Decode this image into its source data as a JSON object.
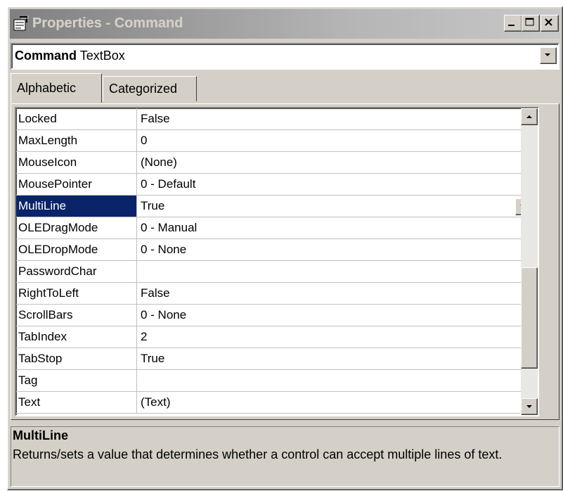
{
  "window": {
    "title": "Properties - Command",
    "icon": "properties-icon"
  },
  "caption_buttons": [
    "minimize-icon",
    "maximize-icon",
    "close-icon"
  ],
  "object_selector": {
    "object_name": "Command",
    "object_type": "TextBox"
  },
  "tabs": [
    {
      "label": "Alphabetic",
      "active": true
    },
    {
      "label": "Categorized",
      "active": false
    }
  ],
  "properties": [
    {
      "name": "Locked",
      "value": "False"
    },
    {
      "name": "MaxLength",
      "value": "0"
    },
    {
      "name": "MouseIcon",
      "value": "(None)"
    },
    {
      "name": "MousePointer",
      "value": "0 - Default"
    },
    {
      "name": "MultiLine",
      "value": "True",
      "selected": true
    },
    {
      "name": "OLEDragMode",
      "value": "0 - Manual"
    },
    {
      "name": "OLEDropMode",
      "value": "0 - None"
    },
    {
      "name": "PasswordChar",
      "value": ""
    },
    {
      "name": "RightToLeft",
      "value": "False"
    },
    {
      "name": "ScrollBars",
      "value": "0 - None"
    },
    {
      "name": "TabIndex",
      "value": "2"
    },
    {
      "name": "TabStop",
      "value": "True"
    },
    {
      "name": "Tag",
      "value": ""
    },
    {
      "name": "Text",
      "value": "(Text)"
    }
  ],
  "description": {
    "title": "MultiLine",
    "text": "Returns/sets a value that determines whether a control can accept multiple lines of text."
  },
  "colors": {
    "selection": "#0a246a",
    "face": "#d4d0c8"
  }
}
